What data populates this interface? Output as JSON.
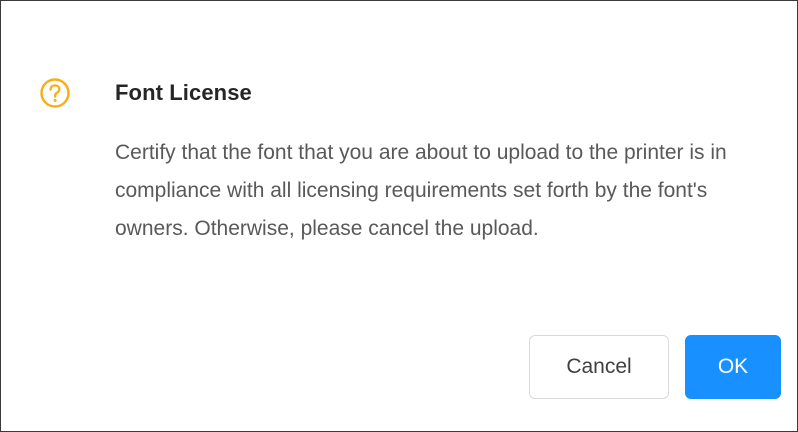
{
  "dialog": {
    "icon": "question-circle-icon",
    "icon_color": "#faad14",
    "title": "Font License",
    "message": "Certify that the font that you are about to upload to the printer is in compliance with all licensing requirements set forth by the font's owners. Otherwise, please cancel the upload.",
    "buttons": {
      "cancel_label": "Cancel",
      "ok_label": "OK"
    },
    "primary_color": "#1890ff"
  }
}
